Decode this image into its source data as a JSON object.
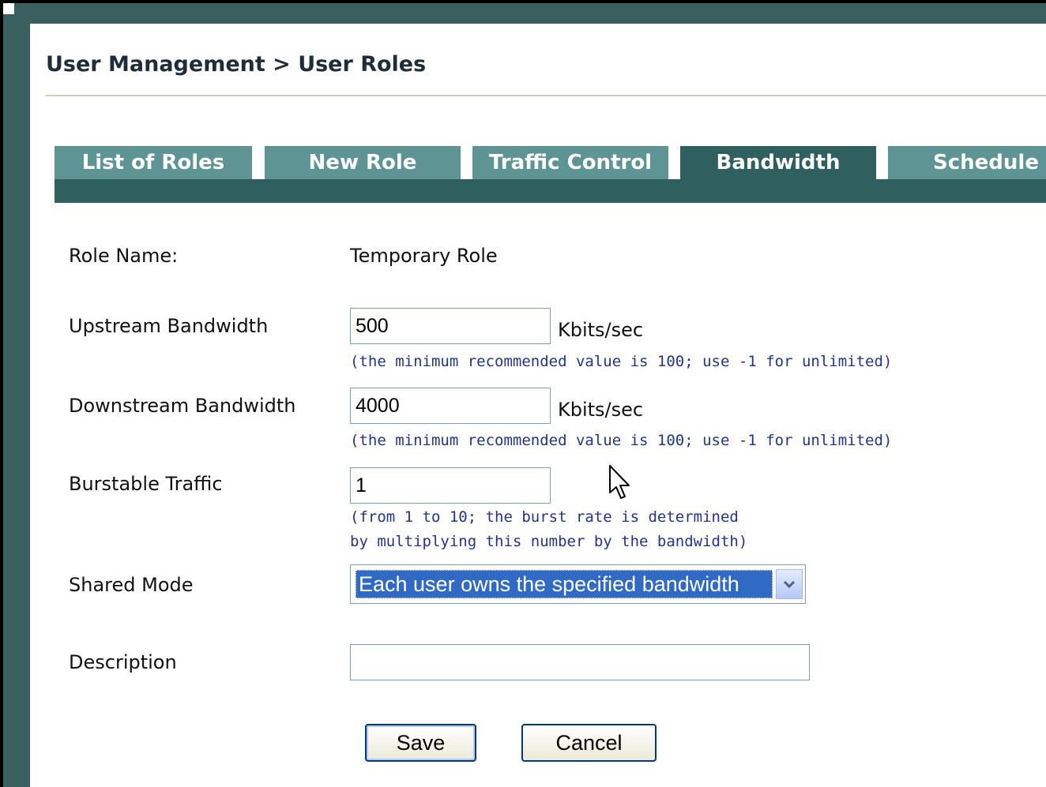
{
  "page": {
    "title": "User Management > User Roles"
  },
  "tabs": [
    {
      "label": "List of Roles",
      "active": false
    },
    {
      "label": "New Role",
      "active": false
    },
    {
      "label": "Traffic Control",
      "active": false
    },
    {
      "label": "Bandwidth",
      "active": true
    },
    {
      "label": "Schedule",
      "active": false
    }
  ],
  "form": {
    "role_name": {
      "label": "Role Name:",
      "value": "Temporary Role"
    },
    "upstream": {
      "label": "Upstream Bandwidth",
      "value": "500",
      "unit": "Kbits/sec",
      "hint": "(the minimum recommended value is 100; use -1 for unlimited)"
    },
    "downstream": {
      "label": "Downstream Bandwidth",
      "value": "4000",
      "unit": "Kbits/sec",
      "hint": "(the minimum recommended value is 100; use -1 for unlimited)"
    },
    "burstable": {
      "label": "Burstable Traffic",
      "value": "1",
      "hint_line1": "(from 1 to 10; the burst rate is determined",
      "hint_line2": "by multiplying this number by the bandwidth)"
    },
    "shared_mode": {
      "label": "Shared Mode",
      "selected": "Each user owns the specified bandwidth"
    },
    "description": {
      "label": "Description",
      "value": ""
    }
  },
  "buttons": {
    "save": "Save",
    "cancel": "Cancel"
  },
  "colors": {
    "frame": "#3a5f5f",
    "tab": "#5f9494",
    "tab_active": "#2f5f5f",
    "hint_text": "#24348a",
    "select_highlight": "#316ac5"
  },
  "icons": {
    "dropdown": "chevron-down-icon",
    "cursor": "mouse-pointer-icon"
  }
}
